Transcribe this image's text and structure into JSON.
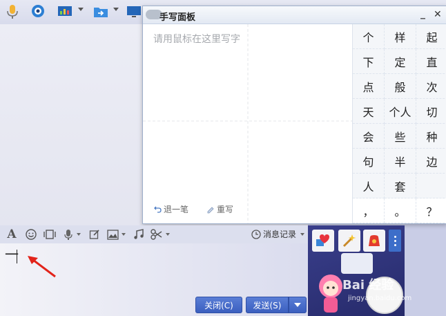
{
  "toolbar": {
    "icons": [
      "microphone-icon",
      "webcam-icon",
      "screen-share-icon",
      "folder-transfer-icon",
      "remote-desktop-icon"
    ]
  },
  "handwriting_panel": {
    "title": "手写面板",
    "placeholder": "请用鼠标在这里写字",
    "undo_label": "退一笔",
    "rewrite_label": "重写",
    "minimize_label": "_",
    "close_label": "✕",
    "candidates": [
      [
        "个",
        "样",
        "起"
      ],
      [
        "下",
        "定",
        "直"
      ],
      [
        "点",
        "般",
        "次"
      ],
      [
        "天",
        "个人",
        "切"
      ],
      [
        "会",
        "些",
        "种"
      ],
      [
        "句",
        "半",
        "边"
      ],
      [
        "人",
        "套",
        ""
      ],
      [
        "，",
        "。",
        "？"
      ]
    ]
  },
  "input_toolbar": {
    "history_label": "消息记录",
    "icons": [
      "font-icon",
      "emoji-icon",
      "screenshot-gallery-icon",
      "voice-icon",
      "edit-icon",
      "image-icon",
      "music-icon",
      "scissors-icon"
    ]
  },
  "input": {
    "text": "一"
  },
  "buttons": {
    "close": "关闭(C)",
    "send": "发送(S)"
  },
  "skin": {
    "watermark": "Bai 经验",
    "url": "jingyan.baidu.com"
  }
}
